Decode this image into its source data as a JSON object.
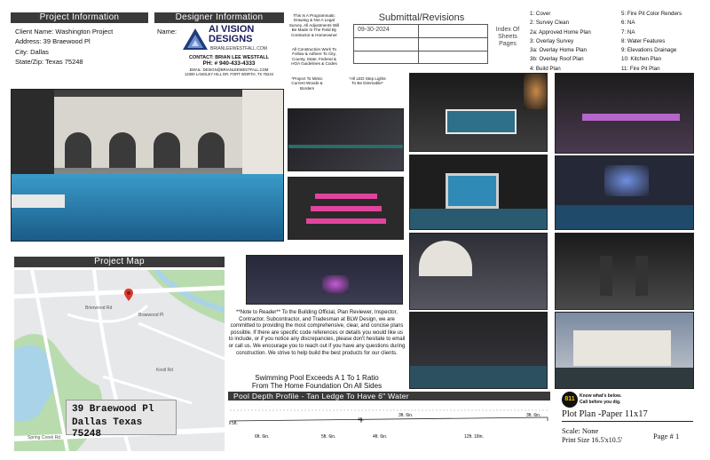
{
  "project_info": {
    "header": "Project Information",
    "client": "Client Name: Washington Project",
    "address": "Address: 39 Braewood Pl",
    "city": "City: Dallas",
    "state_zip": "State/Zip: Texas 75248"
  },
  "designer_info": {
    "header": "Designer Information",
    "name_label": "Name:",
    "logo_title": "AI VISION DESIGNS",
    "logo_url": "BRIANLEEWESTFALL.COM",
    "contact": "CONTACT: BRIAN LEE WESTFALL",
    "phone": "PH: # 940-433-4333",
    "email": "EMAIL: DESIGN@BRIANLEEWESTFALL.COM",
    "address": "12300 LANGLEY HILL DR. FORT WORTH, TX 76244"
  },
  "disclaimer": {
    "line1": "This Is A Programmatic Drawing & Not A Legal Survey. All Adjustments Will Be Made In The Field By Contractor & Homeowner",
    "line2": "All Construction Work To Follow & Adhere To City, County, State, Federal & HOA Guidelines & Codes",
    "line3": "*Project To Mimic Current Woods & Borders",
    "line4": "*All LED Step Lights To Be Dimmable*"
  },
  "submittal": {
    "title": "Submittal/Revisions",
    "date": "09-30-2024",
    "index_label": "Index Of Sheets Pages"
  },
  "sheet_index": {
    "left": [
      "1: Cover",
      "2: Survey Clean",
      "2a: Approved Home Plan",
      "3: Overlay Survey",
      "3a: Overlay Home Plan",
      "3b: Overlay Roof Plan",
      "4: Build Plan"
    ],
    "right": [
      "5: Fire Pit Color Renders",
      "6: NA",
      "7: NA",
      "8: Water Features",
      "9: Elevations Drainage",
      "10: Kitchen Plan",
      "11: Fire Pit Plan"
    ]
  },
  "map": {
    "header": "Project Map",
    "address_line1": "39 Braewood Pl",
    "address_line2": "Dallas Texas 75248",
    "street_labels": [
      "Brierwood Rd",
      "Spring Creek Rd",
      "Braewood Pl",
      "Knoll Rd"
    ]
  },
  "note": {
    "text": "**Note to Reader** To the Building Official, Plan Reviewer, Inspector, Contractor, Subcontractor, and Tradesman at BLW Design, we are committed to providing the most comprehensive, clear, and concise plans possible. If there are specific code references or details you would like us to include, or if you notice any discrepancies, please don't hesitate to email or call us. We encourage you to reach out if you have any questions during construction. We strive to help build the best products for our clients.",
    "pool_line1": "Swimming Pool Exceeds A 1 To 1 Ratio",
    "pool_line2": "From The Home Foundation On All Sides"
  },
  "profile": {
    "title": "Pool Depth Profile - Tan Ledge To Have 6\" Water",
    "labels_top": [
      "5ft.",
      "4ft.",
      "3ft. 6in.",
      "3ft. 6in."
    ],
    "labels_bottom": [
      "6ft. 6in.",
      "5ft. 6in.",
      "4ft. 6in.",
      "12ft. 18in."
    ],
    "labels_mid": [
      "5ft.",
      "5ft."
    ]
  },
  "call811": {
    "badge": "811",
    "line1": "Know what's below.",
    "line2": "Call before you dig."
  },
  "plot": {
    "title": "Plot Plan -Paper 11x17",
    "scale": "Scale: None",
    "print_size": "Print Size 16.5'x10.5'",
    "page": "Page # 1"
  },
  "colors": {
    "header_bg": "#3a3a3a",
    "accent_pink": "#e2449d",
    "pool_blue": "#3a9bc9",
    "map_water": "#a9d3e8",
    "map_park": "#b9dcae"
  }
}
